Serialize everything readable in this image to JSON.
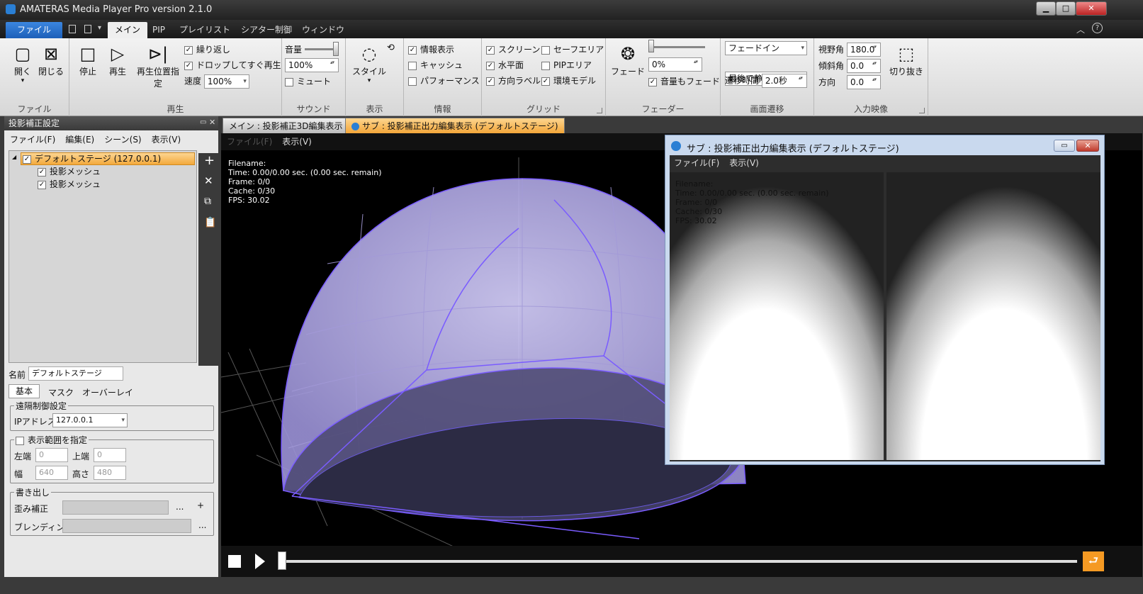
{
  "app": {
    "title": "AMATERAS Media Player Pro version 2.1.0"
  },
  "ribbon_tabs": [
    "ファイル",
    "メイン",
    "PIP",
    "プレイリスト",
    "シアター制御",
    "ウィンドウ"
  ],
  "ribbon": {
    "file": {
      "open": "開く",
      "close": "閉じる",
      "group": "ファイル"
    },
    "play": {
      "stop": "停止",
      "play": "再生",
      "seek": "再生位置指定",
      "loop": "繰り返し",
      "drop_play": "ドロップしてすぐ再生",
      "speed_label": "速度",
      "speed_value": "100%",
      "group": "再生"
    },
    "sound": {
      "volume_label": "音量",
      "volume_value": "100%",
      "mute": "ミュート",
      "group": "サウンド"
    },
    "display": {
      "style": "スタイル",
      "group": "表示"
    },
    "info": {
      "info_show": "情報表示",
      "cache": "キャッシュ",
      "performance": "パフォーマンス",
      "group": "情報"
    },
    "grid": {
      "screen": "スクリーン",
      "safe_area": "セーフエリア",
      "horizontal": "水平面",
      "pip_area": "PIPエリア",
      "direction_label": "方向ラベル",
      "env_model": "環境モデル",
      "group": "グリッド"
    },
    "fader": {
      "fade": "フェード",
      "fade_value": "0%",
      "volume_fade": "音量もフェード",
      "group": "フェーダー"
    },
    "transition": {
      "fade_in": "フェードイン",
      "last_still": "最後で静止",
      "time_label": "遷移時間",
      "time_value": "2.0秒",
      "group": "画面遷移"
    },
    "input": {
      "fov_label": "視野角",
      "fov_value": "180.0",
      "tilt_label": "傾斜角",
      "tilt_value": "0.0",
      "dir_label": "方向",
      "dir_value": "0.0",
      "crop": "切り抜き",
      "group": "入力映像"
    }
  },
  "left_panel": {
    "title": "投影補正設定",
    "menu": [
      "ファイル(F)",
      "編集(E)",
      "シーン(S)",
      "表示(V)"
    ],
    "tree": {
      "root": "デフォルトステージ (127.0.0.1)",
      "children": [
        "投影メッシュ",
        "投影メッシュ"
      ]
    },
    "name_label": "名前",
    "name_value": "デフォルトステージ",
    "tabs": [
      "基本",
      "マスク",
      "オーバーレイ"
    ],
    "remote": {
      "legend": "遠隔制御設定",
      "ip_label": "IPアドレス",
      "ip_value": "127.0.0.1"
    },
    "range": {
      "legend": "表示範囲を指定",
      "left_label": "左端",
      "left_value": "0",
      "top_label": "上端",
      "top_value": "0",
      "width_label": "幅",
      "width_value": "640",
      "height_label": "高さ",
      "height_value": "480"
    },
    "export": {
      "legend": "書き出し",
      "warp_label": "歪み補正",
      "blend_label": "ブレンディング"
    }
  },
  "doc_tabs": [
    "メイン : 投影補正3D編集表示",
    "サブ : 投影補正出力編集表示 (デフォルトステージ)"
  ],
  "main_menu": [
    "ファイル(F)",
    "表示(V)"
  ],
  "overlay": [
    "Filename:",
    "Time: 0.00/0.00 sec. (0.00 sec. remain)",
    "Frame: 0/0",
    "Cache: 0/30",
    "FPS: 30.02"
  ],
  "subwindow": {
    "title": "サブ : 投影補正出力編集表示 (デフォルトステージ)",
    "menu": [
      "ファイル(F)",
      "表示(V)"
    ],
    "overlay": [
      "Filename:",
      "Time: 0.00/0.00 sec. (0.00 sec. remain)",
      "Frame: 0/0",
      "Cache: 0/30",
      "FPS: 30.02"
    ]
  },
  "colors": {
    "accent_blue": "#1e73d6",
    "tab_orange": "#f5b24a",
    "dome_line": "#7a5cff"
  }
}
